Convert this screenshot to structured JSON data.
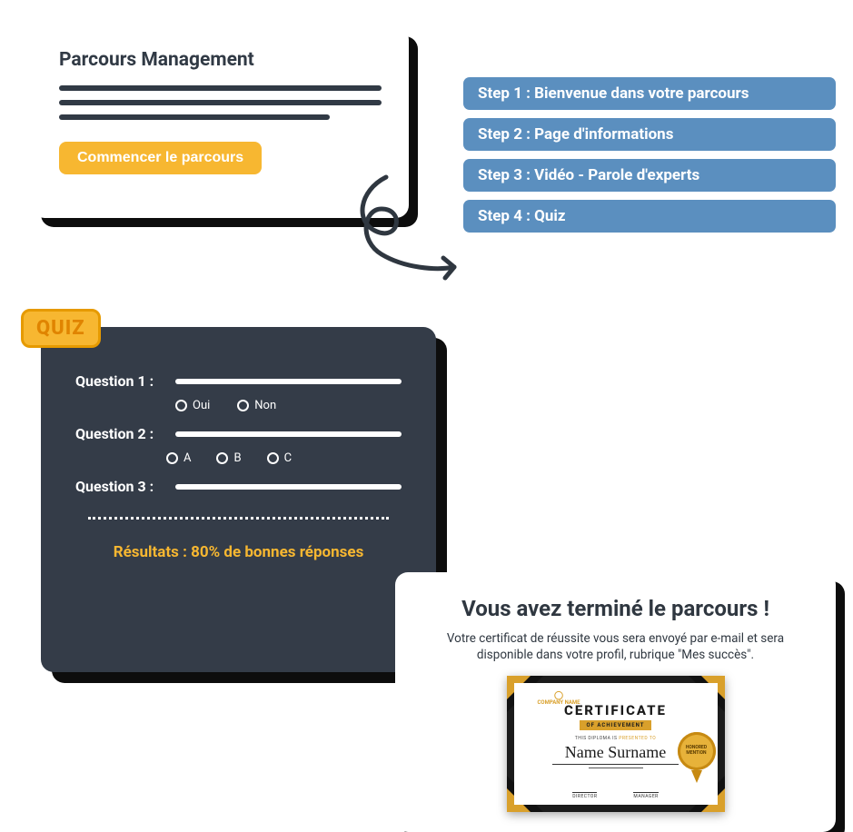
{
  "parcours": {
    "title": "Parcours Management",
    "button": "Commencer le parcours"
  },
  "steps": [
    "Step 1 : Bienvenue dans votre parcours",
    "Step 2 : Page d'informations",
    "Step 3 : Vidéo - Parole d'experts",
    "Step 4 : Quiz"
  ],
  "quiz": {
    "badge": "QUIZ",
    "q1_label": "Question 1 :",
    "q1_options": {
      "a": "Oui",
      "b": "Non"
    },
    "q2_label": "Question 2 :",
    "q2_options": {
      "a": "A",
      "b": "B",
      "c": "C"
    },
    "q3_label": "Question 3 :",
    "results": "Résultats : 80% de bonnes réponses"
  },
  "completion": {
    "title": "Vous avez terminé le parcours !",
    "subtitle": "Votre certificat de réussite vous sera envoyé par e-mail et sera disponible dans votre profil, rubrique \"Mes succès\"."
  },
  "certificate": {
    "company": "COMPANY NAME",
    "title": "CERTIFICATE",
    "banner": "OF ACHIEVEMENT",
    "presented_pre": "THIS DIPLOMA IS",
    "presented_highlight": "PRESENTED TO",
    "name": "Name Surname",
    "seal": "HONORED MENTION",
    "signatures": {
      "left": "DIRECTOR",
      "right": "MANAGER"
    }
  }
}
